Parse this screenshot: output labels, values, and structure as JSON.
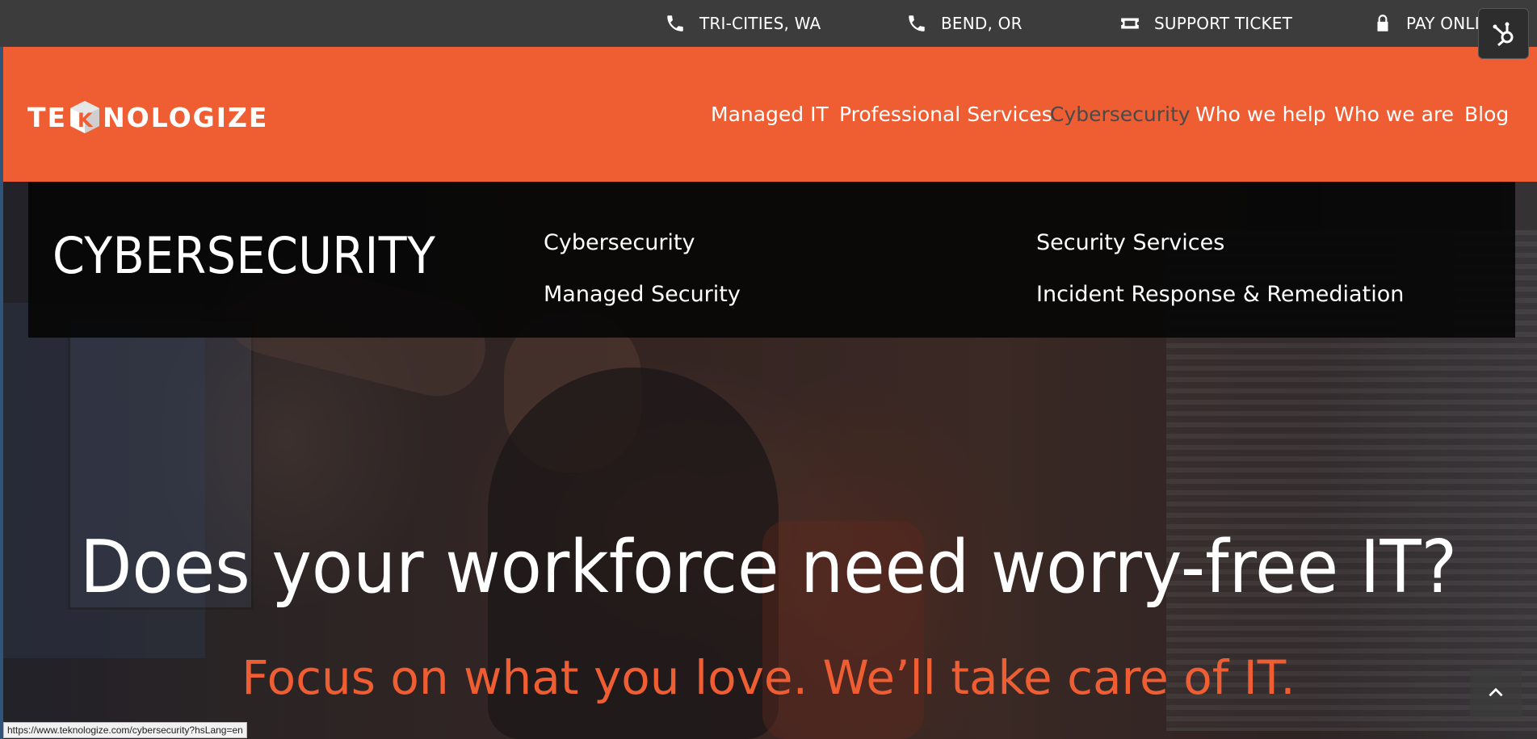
{
  "topbar": {
    "items": [
      {
        "label": "TRI-CITIES, WA",
        "icon": "phone-icon"
      },
      {
        "label": "BEND, OR",
        "icon": "phone-icon"
      },
      {
        "label": "SUPPORT TICKET",
        "icon": "ticket-icon"
      },
      {
        "label": "PAY ONLINE",
        "icon": "lock-icon"
      }
    ]
  },
  "header": {
    "logo_text_left": "TE",
    "logo_text_right": "NOLOGIZE",
    "nav": [
      {
        "label": "Managed IT"
      },
      {
        "label": "Professional Services"
      },
      {
        "label": "Cybersecurity"
      },
      {
        "label": "Who we help"
      },
      {
        "label": "Who we are"
      },
      {
        "label": "Blog"
      }
    ]
  },
  "mega_menu": {
    "title": "CYBERSECURITY",
    "links": [
      {
        "label": "Cybersecurity"
      },
      {
        "label": "Managed Security"
      },
      {
        "label": "Security Services"
      },
      {
        "label": "Incident Response & Remediation"
      }
    ]
  },
  "hero": {
    "headline": "Does your workforce need worry-free IT?",
    "subline": "Focus on what you love. We’ll take care of IT."
  },
  "status_bar": {
    "url": "https://www.teknologize.com/cybersecurity?hsLang=en"
  },
  "colors": {
    "brand_orange": "#ef5d33",
    "topbar_bg": "#3c3c3c",
    "active_nav": "#4a4a4a"
  }
}
